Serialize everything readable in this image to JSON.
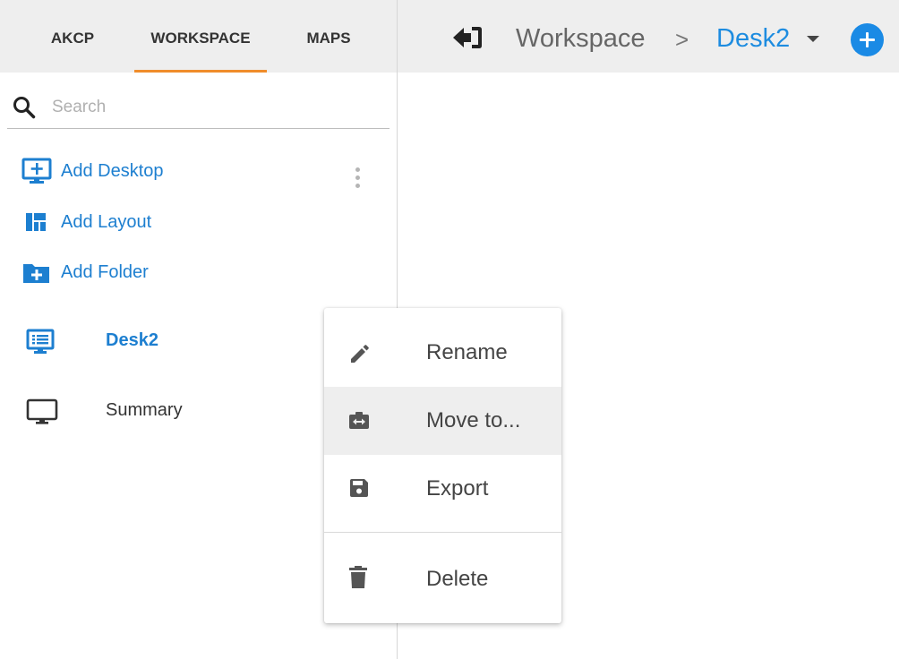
{
  "tabs": [
    {
      "label": "AKCP",
      "active": false
    },
    {
      "label": "WORKSPACE",
      "active": true
    },
    {
      "label": "MAPS",
      "active": false
    }
  ],
  "breadcrumb": {
    "root": "Workspace",
    "separator": ">",
    "current": "Desk2"
  },
  "search": {
    "placeholder": "Search",
    "value": ""
  },
  "actions": {
    "add_desktop": "Add Desktop",
    "add_layout": "Add Layout",
    "add_folder": "Add Folder"
  },
  "list": [
    {
      "label": "Desk2",
      "icon": "desktop-list-icon",
      "selected": true
    },
    {
      "label": "Summary",
      "icon": "monitor-icon",
      "selected": false
    }
  ],
  "context_menu": {
    "items": [
      {
        "label": "Rename",
        "icon": "pencil-icon",
        "highlighted": false
      },
      {
        "label": "Move to...",
        "icon": "move-icon",
        "highlighted": true
      },
      {
        "label": "Export",
        "icon": "save-icon",
        "highlighted": false
      },
      {
        "label": "Delete",
        "icon": "trash-icon",
        "highlighted": false
      }
    ]
  },
  "colors": {
    "accent_blue": "#1d7fd0",
    "fab_blue": "#1a8ae5",
    "tab_underline": "#f08d2b",
    "header_bg": "#eeeeee",
    "menu_highlight": "#eeeeee"
  }
}
